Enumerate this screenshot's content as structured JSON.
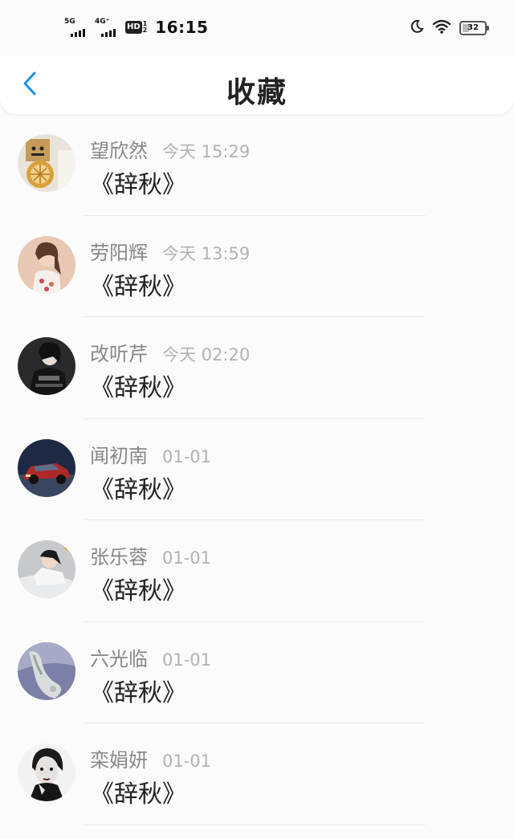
{
  "status_bar": {
    "network_1": "5G",
    "network_2": "4G⁺",
    "hd_label": "HD",
    "hd_sub_top": "1",
    "hd_sub_bottom": "2",
    "time": "16:15",
    "battery_percent": "32",
    "battery_level": 0.32
  },
  "header": {
    "back_icon": "chevron-left-icon",
    "title": "收藏",
    "accent_color": "#1a8fe3"
  },
  "favorites": [
    {
      "name": "望欣然",
      "time": "今天 15:29",
      "content": "《辞秋》",
      "avatar": "cardboard-robot-avatar"
    },
    {
      "name": "劳阳辉",
      "time": "今天 13:59",
      "content": "《辞秋》",
      "avatar": "woman-portrait-avatar"
    },
    {
      "name": "改听芹",
      "time": "今天 02:20",
      "content": "《辞秋》",
      "avatar": "dark-fashion-avatar"
    },
    {
      "name": "闻初南",
      "time": "01-01",
      "content": "《辞秋》",
      "avatar": "red-car-avatar"
    },
    {
      "name": "张乐蓉",
      "time": "01-01",
      "content": "《辞秋》",
      "avatar": "girl-lying-avatar"
    },
    {
      "name": "六光临",
      "time": "01-01",
      "content": "《辞秋》",
      "avatar": "sculpture-avatar"
    },
    {
      "name": "栾娟妍",
      "time": "01-01",
      "content": "《辞秋》",
      "avatar": "bw-portrait-avatar"
    }
  ]
}
